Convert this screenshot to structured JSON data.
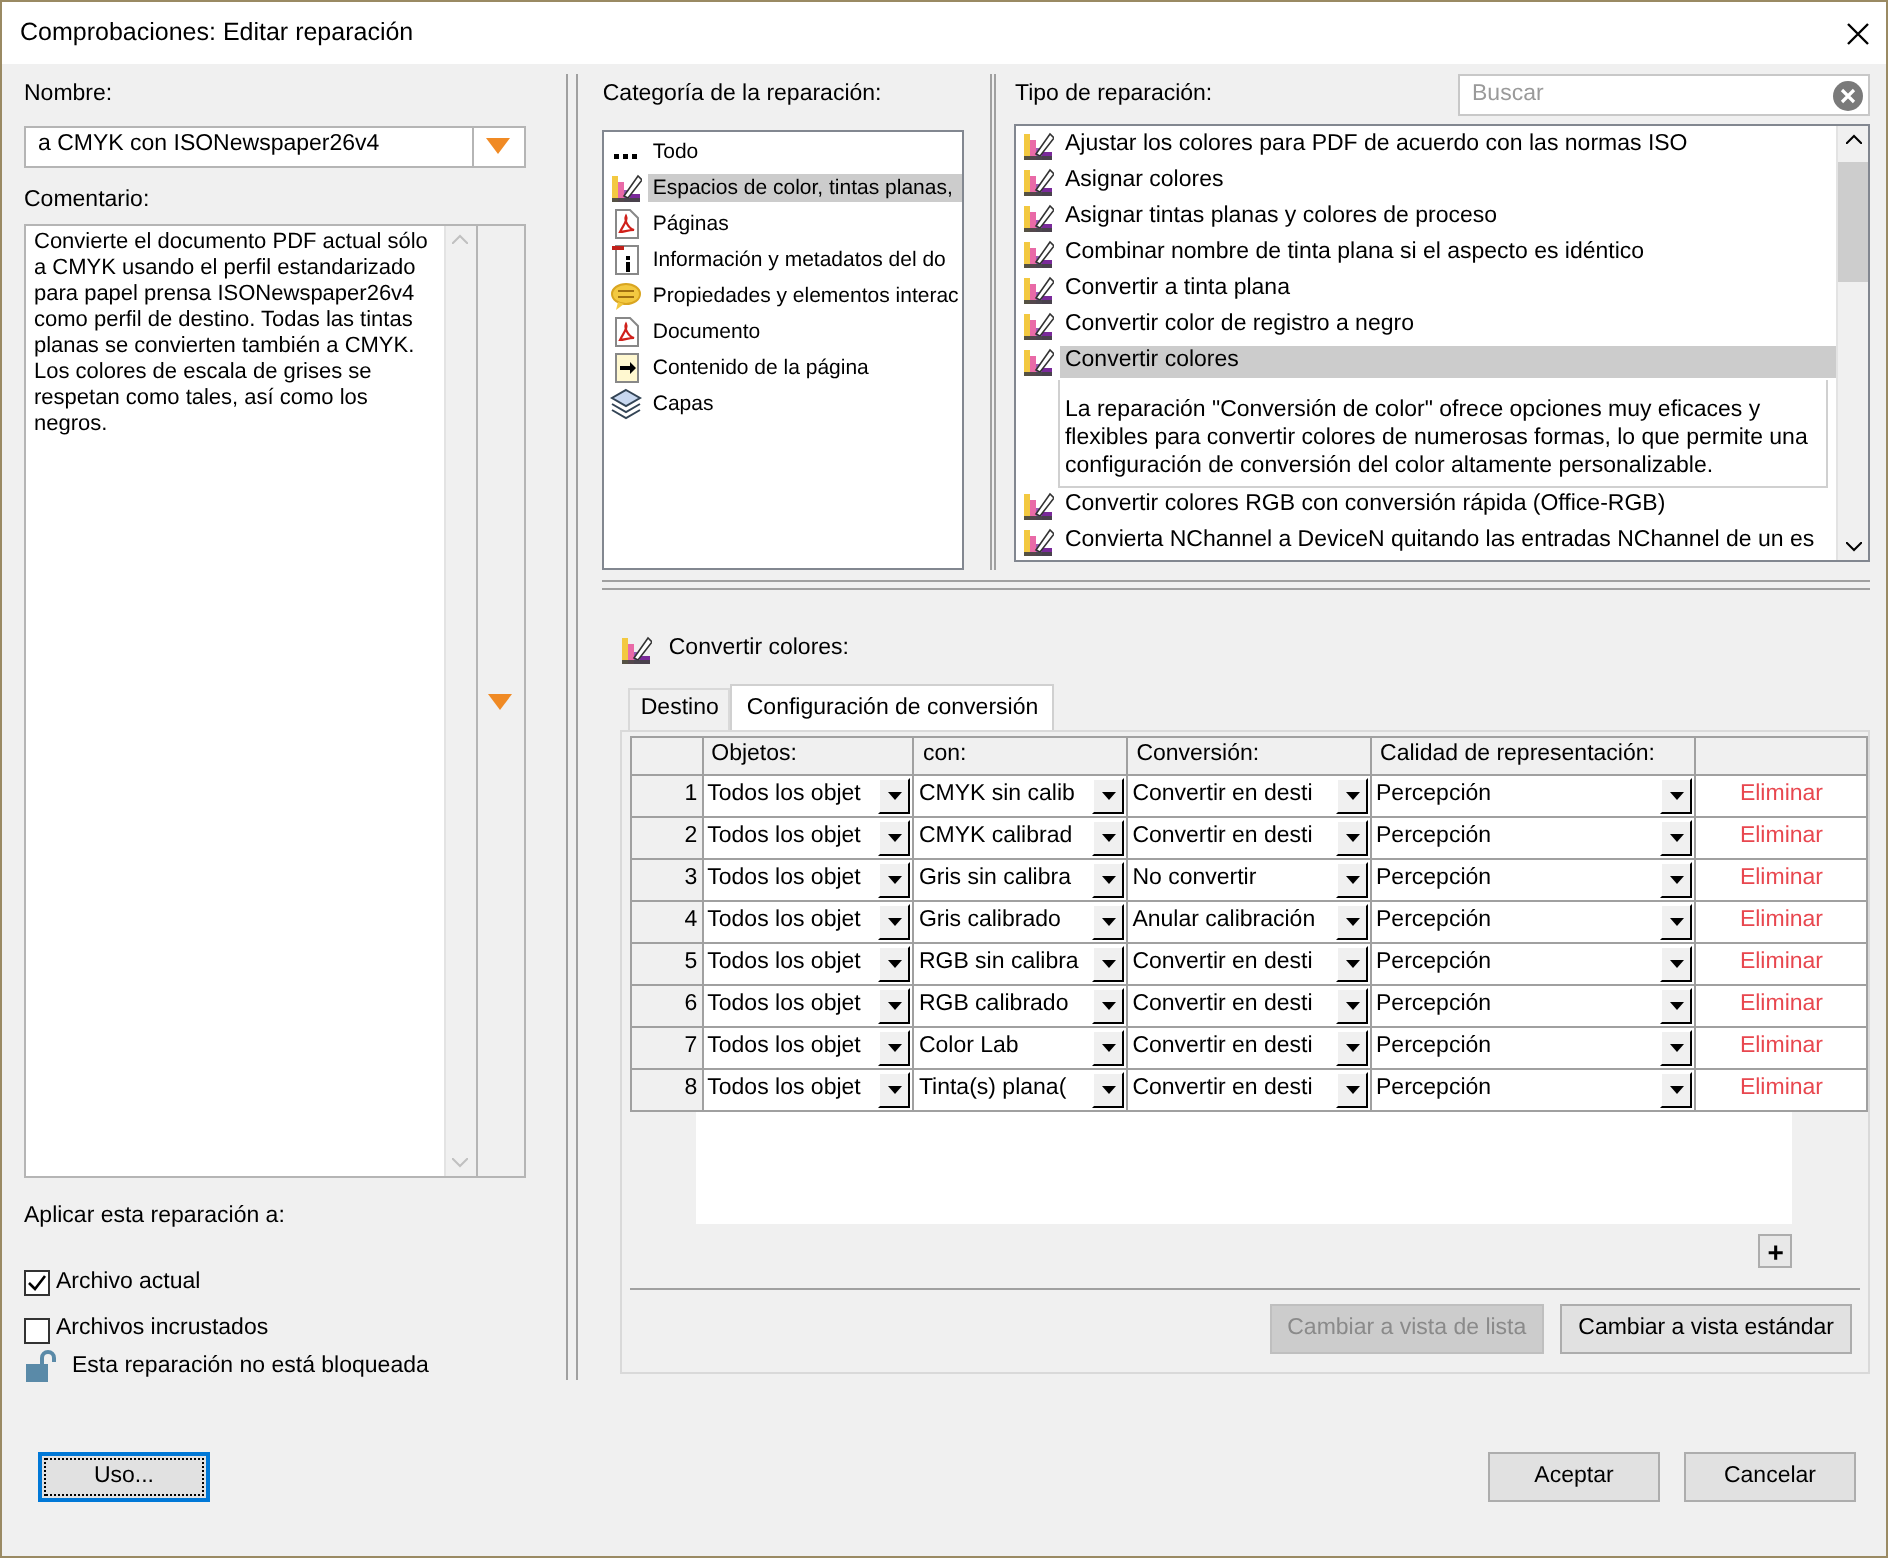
{
  "window": {
    "title": "Comprobaciones: Editar reparación"
  },
  "left": {
    "name_label": "Nombre:",
    "name_value": "a CMYK con ISONewspaper26v4",
    "comment_label": "Comentario:",
    "comment": "Convierte el documento PDF actual sólo a CMYK usando el perfil estandarizado para papel prensa ISONewspaper26v4 como perfil de destino. Todas las tintas planas se convierten también a CMYK. Los colores de escala de grises se respetan como tales, así como los negros.",
    "apply_label": "Aplicar esta reparación a:",
    "apply_options": [
      {
        "label": "Archivo actual",
        "checked": true
      },
      {
        "label": "Archivos incrustados",
        "checked": false
      }
    ],
    "lock_text": "Esta reparación no está bloqueada"
  },
  "categories": {
    "label": "Categoría de la reparación:",
    "items": [
      {
        "label": "Todo",
        "kind": "dots",
        "selected": false
      },
      {
        "label": "Espacios de color, tintas planas,",
        "kind": "color",
        "selected": true
      },
      {
        "label": "Páginas",
        "kind": "pdf",
        "selected": false
      },
      {
        "label": "Información y metadatos del do",
        "kind": "info",
        "selected": false
      },
      {
        "label": "Propiedades y elementos interac",
        "kind": "comment",
        "selected": false
      },
      {
        "label": "Documento",
        "kind": "pdf",
        "selected": false
      },
      {
        "label": "Contenido de la página",
        "kind": "content",
        "selected": false
      },
      {
        "label": "Capas",
        "kind": "layers",
        "selected": false
      }
    ]
  },
  "fixups": {
    "label": "Tipo de reparación:",
    "search": {
      "placeholder": "Buscar"
    },
    "items": [
      {
        "label": "Ajustar los colores para PDF de acuerdo con las normas ISO",
        "selected": false
      },
      {
        "label": "Asignar colores",
        "selected": false
      },
      {
        "label": "Asignar tintas planas y colores de proceso",
        "selected": false
      },
      {
        "label": "Combinar nombre de tinta plana si el aspecto es idéntico",
        "selected": false
      },
      {
        "label": "Convertir a tinta plana",
        "selected": false
      },
      {
        "label": "Convertir color de registro a negro",
        "selected": false
      },
      {
        "label": "Convertir colores",
        "selected": true,
        "description": "La reparación \"Conversión de color\" ofrece opciones muy eficaces y flexibles para convertir colores de numerosas formas, lo que permite una configuración de conversión del color altamente personalizable."
      },
      {
        "label": "Convertir colores RGB con conversión rápida (Office-RGB)",
        "selected": false
      },
      {
        "label": "Convierta NChannel a DeviceN quitando las entradas NChannel de un es",
        "selected": false
      }
    ]
  },
  "editor": {
    "title": "Convertir colores:",
    "tabs": [
      {
        "label": "Destino",
        "selected": false
      },
      {
        "label": "Configuración de conversión",
        "selected": true
      }
    ],
    "table": {
      "columns": [
        "Objetos:",
        "con:",
        "Conversión:",
        "Calidad de representación:"
      ],
      "rows": [
        {
          "number": "1",
          "objects": "Todos los objet",
          "with": "CMYK sin calib",
          "conversion": "Convertir en desti",
          "quality": "Percepción",
          "action": "Eliminar"
        },
        {
          "number": "2",
          "objects": "Todos los objet",
          "with": "CMYK calibrad",
          "conversion": "Convertir en desti",
          "quality": "Percepción",
          "action": "Eliminar"
        },
        {
          "number": "3",
          "objects": "Todos los objet",
          "with": "Gris sin calibra",
          "conversion": "No convertir",
          "quality": "Percepción",
          "action": "Eliminar"
        },
        {
          "number": "4",
          "objects": "Todos los objet",
          "with": "Gris calibrado",
          "conversion": "Anular calibración",
          "quality": "Percepción",
          "action": "Eliminar"
        },
        {
          "number": "5",
          "objects": "Todos los objet",
          "with": "RGB sin calibra",
          "conversion": "Convertir en desti",
          "quality": "Percepción",
          "action": "Eliminar"
        },
        {
          "number": "6",
          "objects": "Todos los objet",
          "with": "RGB calibrado",
          "conversion": "Convertir en desti",
          "quality": "Percepción",
          "action": "Eliminar"
        },
        {
          "number": "7",
          "objects": "Todos los objet",
          "with": "Color Lab",
          "conversion": "Convertir en desti",
          "quality": "Percepción",
          "action": "Eliminar"
        },
        {
          "number": "8",
          "objects": "Todos los objet",
          "with": "Tinta(s) plana(",
          "conversion": "Convertir en desti",
          "quality": "Percepción",
          "action": "Eliminar"
        }
      ]
    },
    "add_button": "+",
    "buttons": [
      {
        "label": "Cambiar a vista de lista",
        "disabled": true
      },
      {
        "label": "Cambiar a vista estándar",
        "disabled": false
      }
    ]
  },
  "footer": {
    "usage_button": "Uso...",
    "buttons": [
      "Aceptar",
      "Cancelar"
    ]
  }
}
